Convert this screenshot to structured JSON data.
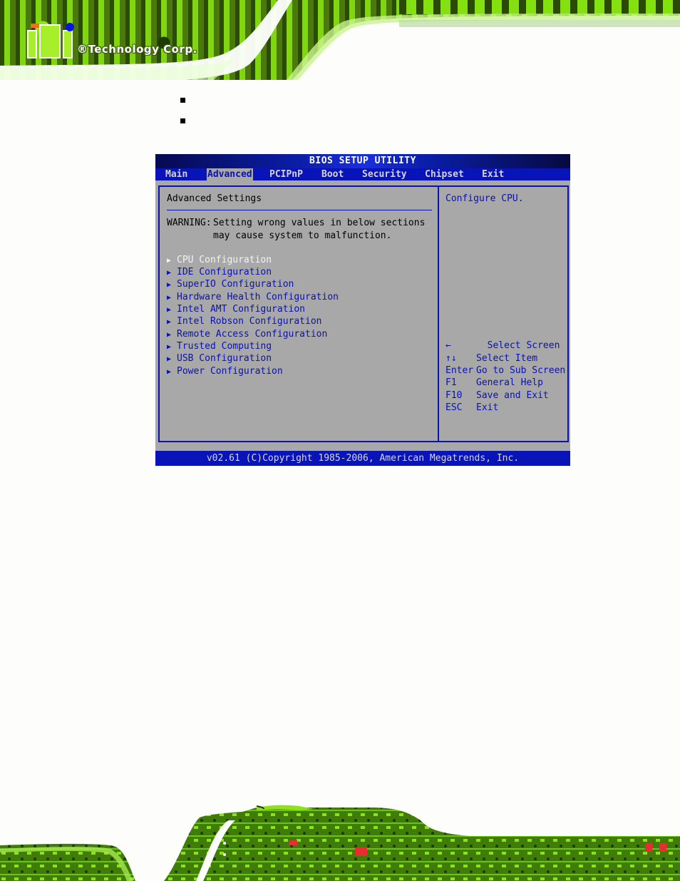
{
  "header": {
    "logo_text": "®Technology Corp.",
    "logo_mark": "iEi"
  },
  "bullets": [
    "",
    ""
  ],
  "bios": {
    "title": "BIOS SETUP UTILITY",
    "tabs": [
      {
        "label": "Main",
        "active": false
      },
      {
        "label": "Advanced",
        "active": true
      },
      {
        "label": "PCIPnP",
        "active": false
      },
      {
        "label": "Boot",
        "active": false
      },
      {
        "label": "Security",
        "active": false
      },
      {
        "label": "Chipset",
        "active": false
      },
      {
        "label": "Exit",
        "active": false
      }
    ],
    "section_title": "Advanced Settings",
    "warning_label": "WARNING:",
    "warning_line1": "Setting wrong values in below sections",
    "warning_line2": "may cause system to malfunction.",
    "menu_arrow": "▶",
    "menu_items": [
      {
        "label": "CPU Configuration",
        "selected": true
      },
      {
        "label": "IDE Configuration",
        "selected": false
      },
      {
        "label": "SuperIO Configuration",
        "selected": false
      },
      {
        "label": "Hardware Health Configuration",
        "selected": false
      },
      {
        "label": "Intel AMT Configuration",
        "selected": false
      },
      {
        "label": "Intel Robson Configuration",
        "selected": false
      },
      {
        "label": "Remote Access Configuration",
        "selected": false
      },
      {
        "label": "Trusted Computing",
        "selected": false
      },
      {
        "label": "USB Configuration",
        "selected": false
      },
      {
        "label": "Power Configuration",
        "selected": false
      }
    ],
    "help_text": "Configure CPU.",
    "key_help": [
      {
        "key": "←",
        "action": "  Select Screen"
      },
      {
        "key": "↑↓",
        "action": "Select Item"
      },
      {
        "key": "Enter",
        "action": "Go to Sub Screen"
      },
      {
        "key": "F1",
        "action": "General Help"
      },
      {
        "key": "F10",
        "action": "Save and Exit"
      },
      {
        "key": "ESC",
        "action": "Exit"
      }
    ],
    "footer": "v02.61 (C)Copyright 1985-2006, American Megatrends, Inc.",
    "colors": {
      "menubar_blue": "#0813b8",
      "panel_gray": "#a8a8a8",
      "item_blue": "#0a12b0",
      "selected_white": "#f4f4f4"
    }
  }
}
